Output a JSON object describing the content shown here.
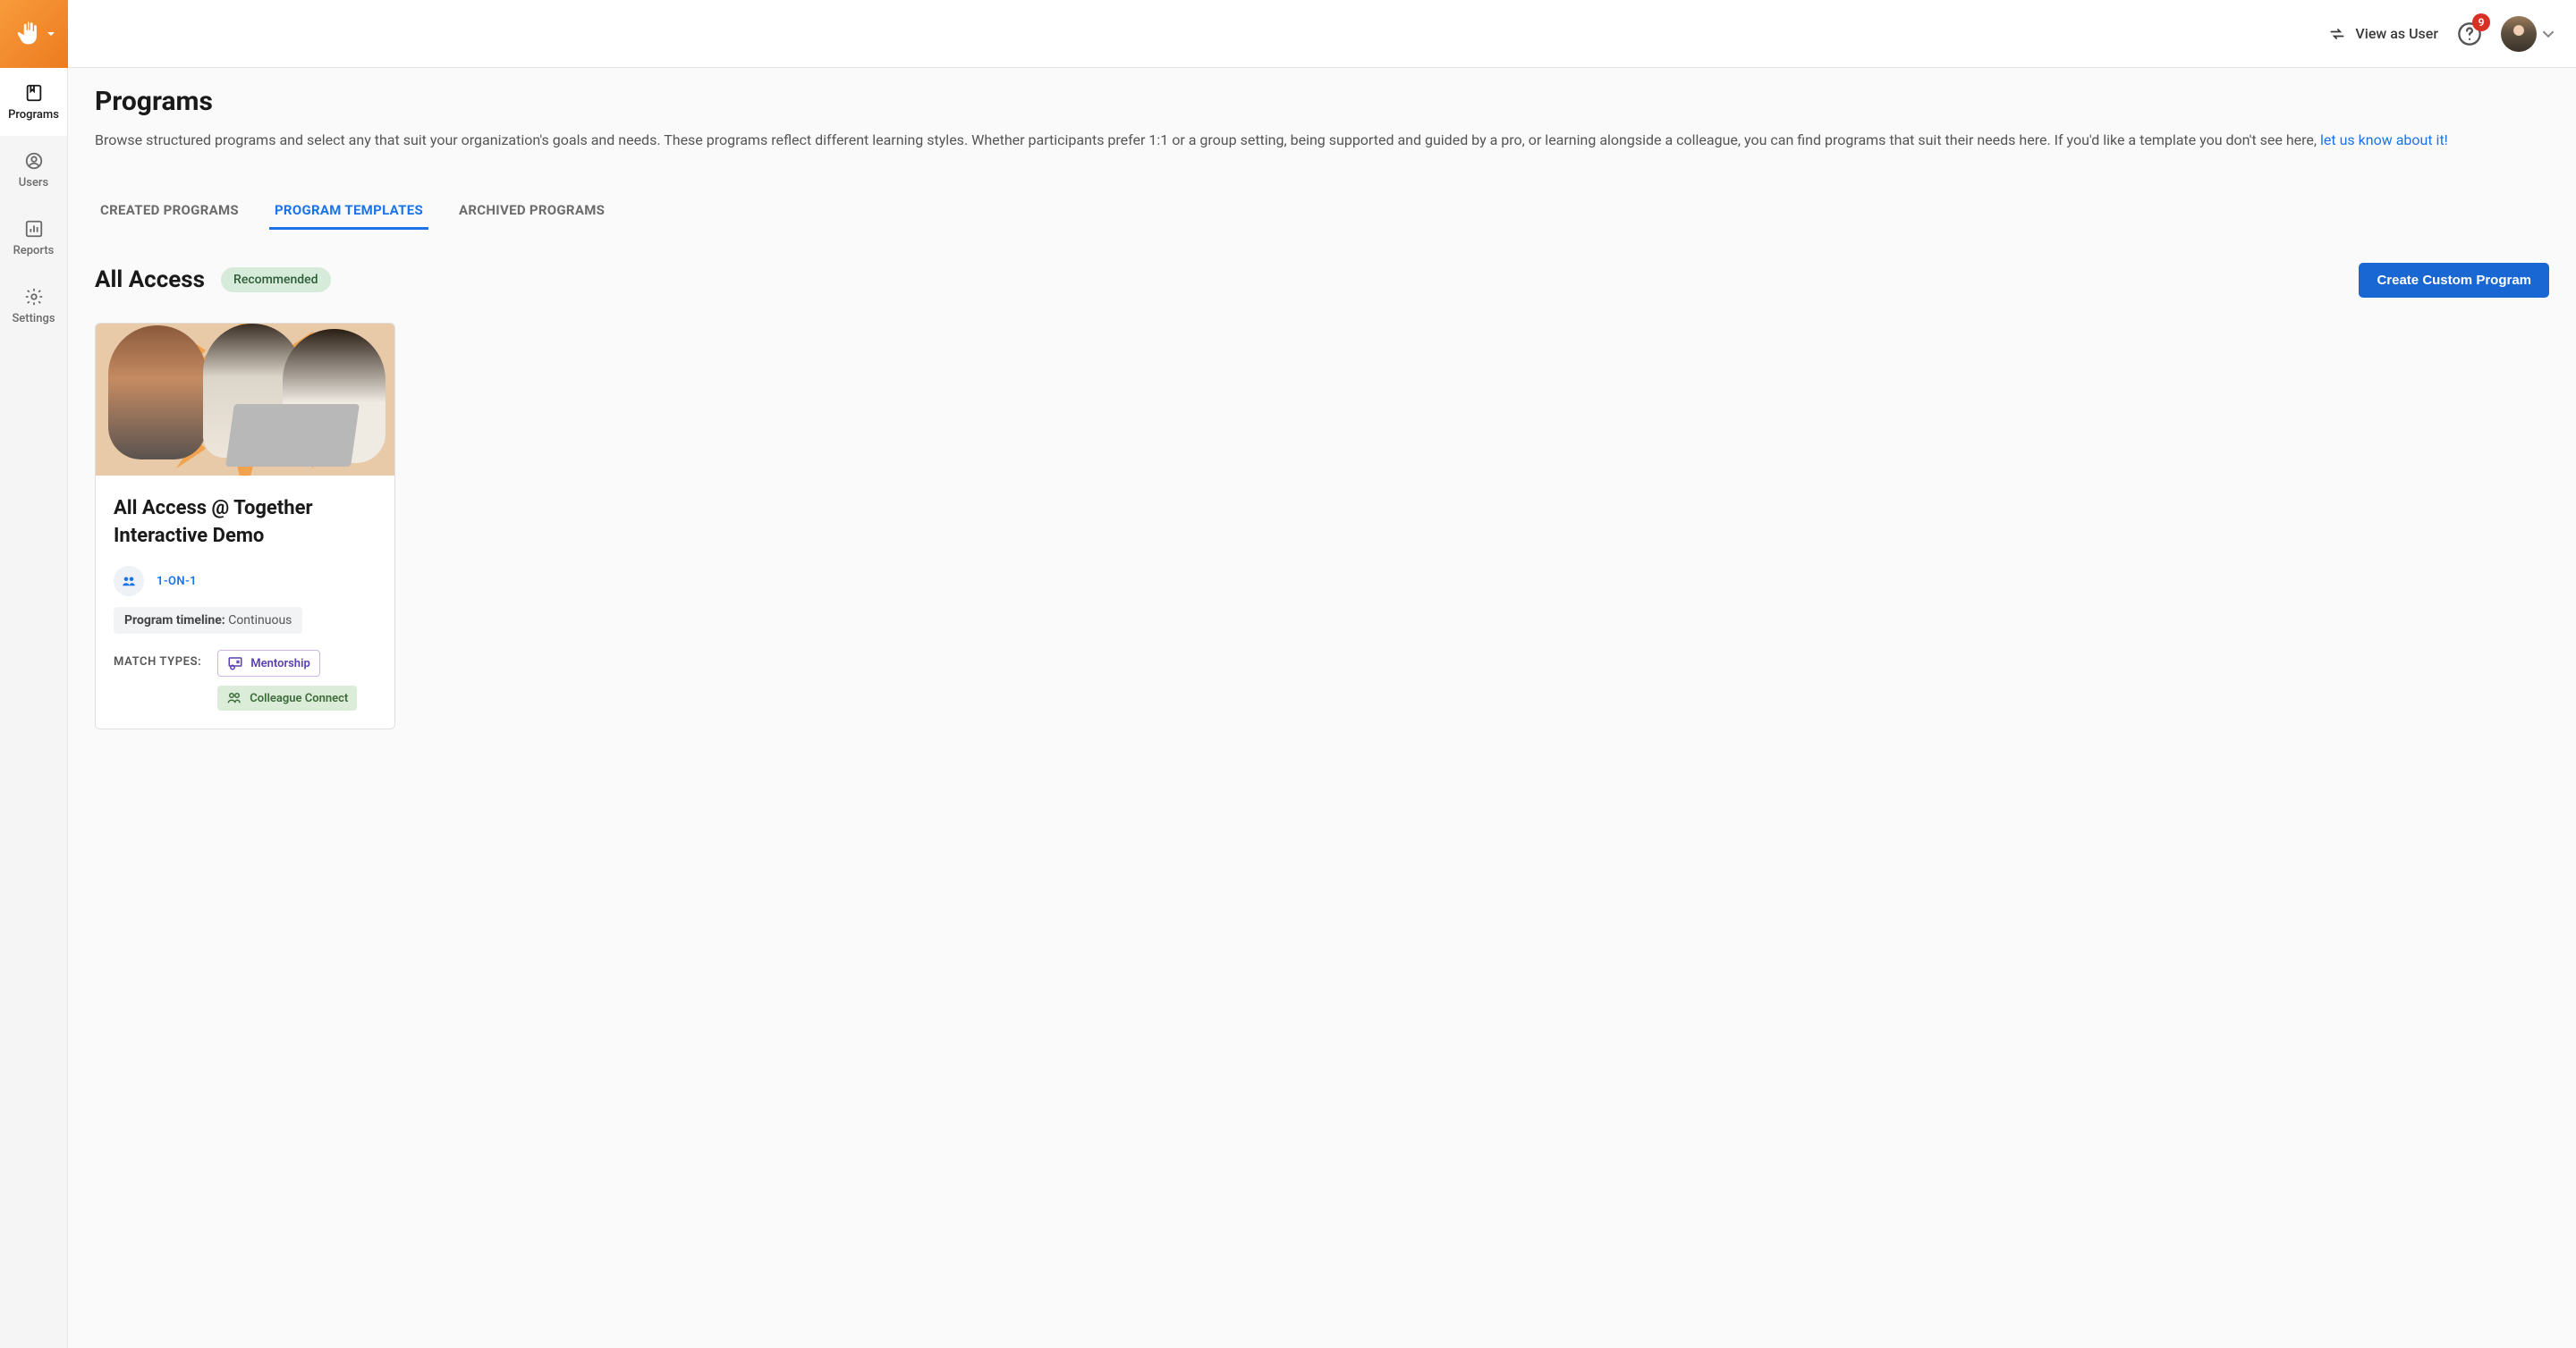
{
  "sidebar": {
    "items": [
      {
        "label": "Programs"
      },
      {
        "label": "Users"
      },
      {
        "label": "Reports"
      },
      {
        "label": "Settings"
      }
    ]
  },
  "topbar": {
    "view_as_label": "View as User",
    "notification_count": "9"
  },
  "page": {
    "title": "Programs",
    "description_prefix": "Browse structured programs and select any that suit your organization's goals and needs. These programs reflect different learning styles. Whether participants prefer 1:1 or a group setting, being supported and guided by a pro, or learning alongside a colleague, you can find programs that suit their needs here. If you'd like a template you don't see here, ",
    "description_link": "let us know about it!"
  },
  "tabs": [
    {
      "label": "CREATED PROGRAMS"
    },
    {
      "label": "PROGRAM TEMPLATES"
    },
    {
      "label": "ARCHIVED PROGRAMS"
    }
  ],
  "section": {
    "title": "All Access",
    "badge": "Recommended",
    "button": "Create Custom Program"
  },
  "card": {
    "title": "All Access @ Together Interactive Demo",
    "format": "1-ON-1",
    "timeline_label": "Program timeline:",
    "timeline_value": " Continuous",
    "match_label": "MATCH TYPES:",
    "match_types": {
      "mentorship": "Mentorship",
      "colleague": "Colleague Connect"
    }
  }
}
